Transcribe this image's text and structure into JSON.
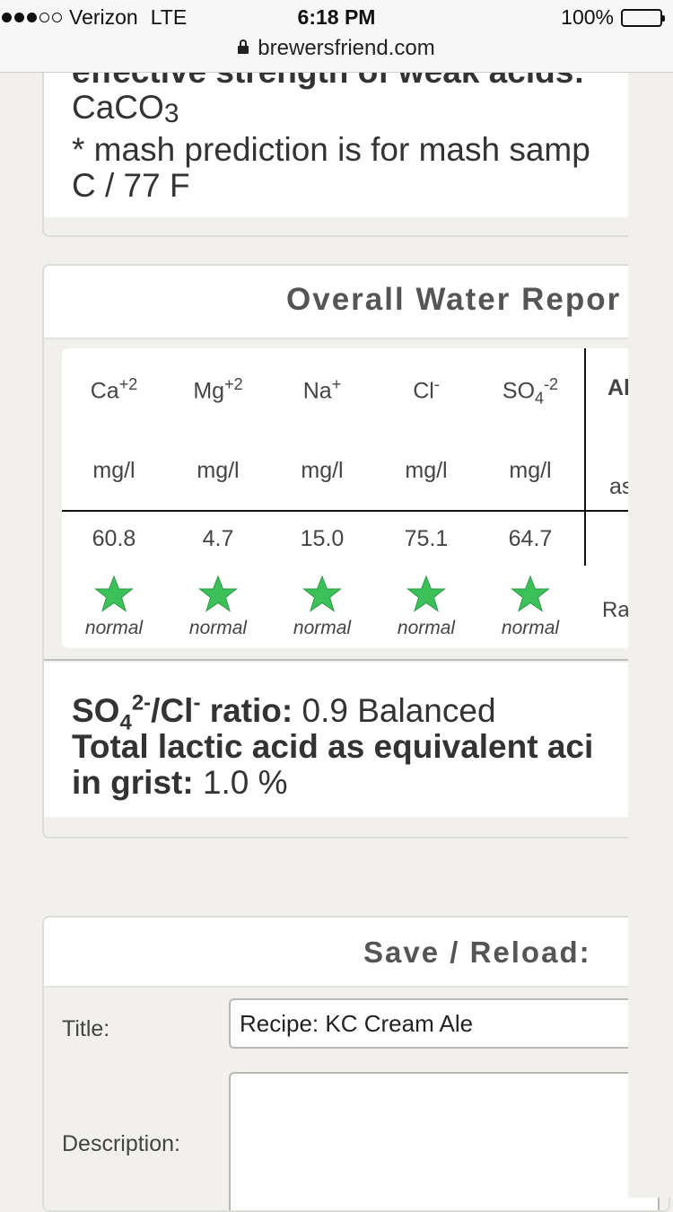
{
  "status_bar": {
    "carrier": "Verizon",
    "network": "LTE",
    "time": "6:18 PM",
    "battery": "100%",
    "url": "brewersfriend.com"
  },
  "top_panel": {
    "line1": "effective strength of weak acids:",
    "line2_main": "CaCO",
    "line2_sub": "3",
    "line3": "* mash prediction is for mash samp",
    "line4": "C / 77 F"
  },
  "report": {
    "title": "Overall Water Repor",
    "columns": [
      {
        "ion": "Ca",
        "charge": "+2",
        "unit": "mg/l",
        "value": "60.8",
        "status": "normal"
      },
      {
        "ion": "Mg",
        "charge": "+2",
        "unit": "mg/l",
        "value": "4.7",
        "status": "normal"
      },
      {
        "ion": "Na",
        "charge": "+",
        "unit": "mg/l",
        "value": "15.0",
        "status": "normal"
      },
      {
        "ion": "Cl",
        "charge": "-",
        "unit": "mg/l",
        "value": "75.1",
        "status": "normal"
      },
      {
        "ion": "SO",
        "sub": "4",
        "charge": "-2",
        "unit": "mg/l",
        "value": "64.7",
        "status": "normal"
      }
    ],
    "extra_col_head": "Al",
    "extra_col_unit": "as",
    "extra_col_rating": "Ra",
    "star_color": "#3cc05a",
    "ratio_label_so": "SO",
    "ratio_label_sub": "4",
    "ratio_label_sup": "2-",
    "ratio_label_slash": "/Cl",
    "ratio_label_cl_sup": "-",
    "ratio_label_tail": " ratio:",
    "ratio_value": "0.9 Balanced",
    "lactic_line1": "Total lactic acid as equivalent aci",
    "lactic_line2_label": "in grist:",
    "lactic_value": "1.0 %"
  },
  "save": {
    "title": "Save / Reload:",
    "title_label": "Title:",
    "title_value": "Recipe: KC Cream Ale",
    "description_label": "Description:",
    "description_value": ""
  }
}
